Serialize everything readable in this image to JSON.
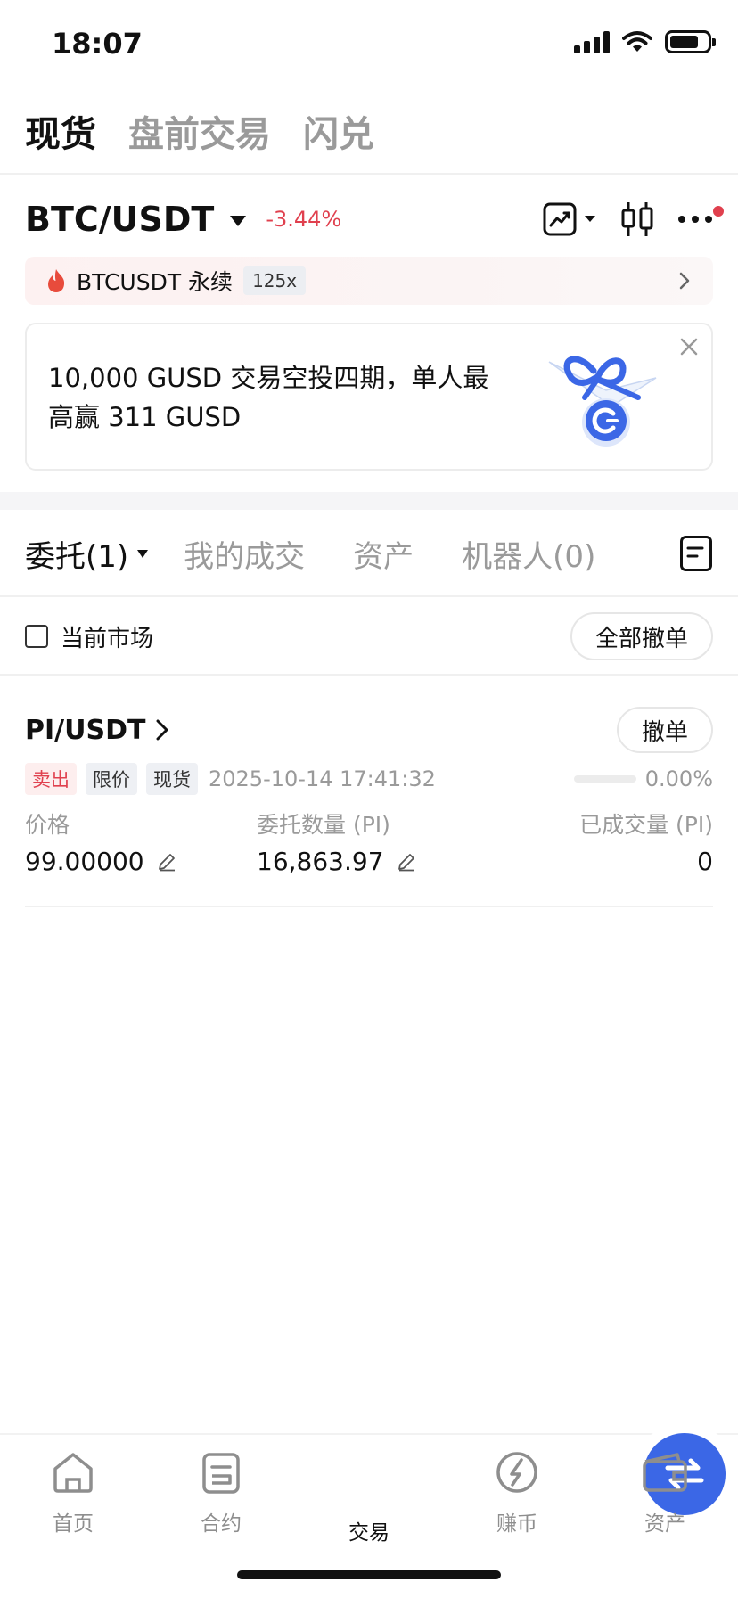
{
  "status_bar": {
    "time": "18:07"
  },
  "top_tabs": [
    {
      "label": "现货",
      "active": true
    },
    {
      "label": "盘前交易",
      "active": false
    },
    {
      "label": "闪兑",
      "active": false
    }
  ],
  "pair": {
    "name": "BTC/USDT",
    "change": "-3.44%"
  },
  "perpetual": {
    "text": "BTCUSDT 永续",
    "leverage": "125x"
  },
  "promo": {
    "text": "10,000 GUSD 交易空投四期，单人最高赢 311 GUSD"
  },
  "order_tabs": [
    {
      "label": "委托(1)",
      "active": true
    },
    {
      "label": "我的成交",
      "active": false
    },
    {
      "label": "资产",
      "active": false
    },
    {
      "label": "机器人(0)",
      "active": false
    }
  ],
  "filter": {
    "current_market_label": "当前市场",
    "cancel_all_label": "全部撤单"
  },
  "order": {
    "pair": "PI/USDT",
    "cancel_label": "撤单",
    "side": "卖出",
    "type": "限价",
    "market": "现货",
    "time": "2025-10-14 17:41:32",
    "filled_percent": "0.00%",
    "filled_fraction": 0.0,
    "price_label": "价格",
    "price": "99.00000",
    "amount_label": "委托数量 (PI)",
    "amount": "16,863.97",
    "filled_label": "已成交量 (PI)",
    "filled": "0"
  },
  "bottom_nav": [
    {
      "label": "首页",
      "icon": "home-icon",
      "active": false
    },
    {
      "label": "合约",
      "icon": "contract-icon",
      "active": false
    },
    {
      "label": "交易",
      "icon": "swap-icon",
      "active": true
    },
    {
      "label": "赚币",
      "icon": "earn-icon",
      "active": false
    },
    {
      "label": "资产",
      "icon": "wallet-icon",
      "active": false
    }
  ],
  "colors": {
    "accent": "#3b67e6",
    "negative": "#e0404e",
    "muted": "#9a9a9a"
  }
}
